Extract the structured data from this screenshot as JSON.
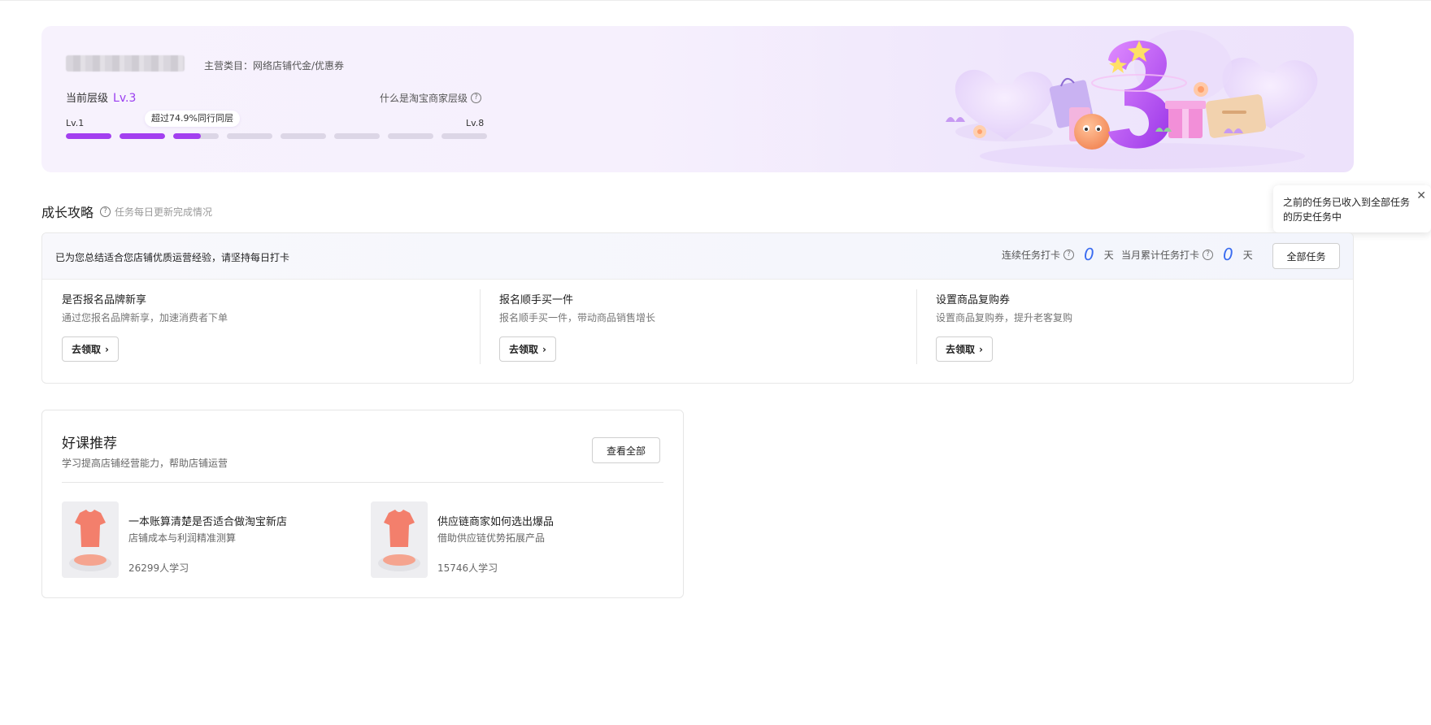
{
  "level_card": {
    "main_category": "主营类目：网络店铺代金/优惠券",
    "current_level_label": "当前层级",
    "current_level_value": "Lv.3",
    "what_is_level": "什么是淘宝商家层级",
    "level_min": "Lv.1",
    "level_max": "Lv.8",
    "percentile_text": "超过74.9%同行同层",
    "progress_segments": [
      1,
      1,
      0.6,
      0,
      0,
      0,
      0,
      0
    ],
    "progress_color": "#a33ff0"
  },
  "growth": {
    "title": "成长攻略",
    "subtitle": "任务每日更新完成情况",
    "banner_message": "已为您总结适合您店铺优质运营经验，请坚持每日打卡",
    "streak_label": "连续任务打卡",
    "streak_value": "0",
    "streak_unit": "天",
    "monthly_label": "当月累计任务打卡",
    "monthly_value": "0",
    "monthly_unit": "天",
    "all_tasks_button": "全部任务",
    "tasks": [
      {
        "title": "是否报名品牌新享",
        "desc": "通过您报名品牌新享，加速消费者下单",
        "action": "去领取"
      },
      {
        "title": "报名顺手买一件",
        "desc": "报名顺手买一件，带动商品销售增长",
        "action": "去领取"
      },
      {
        "title": "设置商品复购券",
        "desc": "设置商品复购券，提升老客复购",
        "action": "去领取"
      }
    ]
  },
  "tooltip": {
    "text": "之前的任务已收入到全部任务的历史任务中"
  },
  "courses": {
    "title": "好课推荐",
    "subtitle": "学习提高店铺经营能力，帮助店铺运营",
    "view_all": "查看全部",
    "items": [
      {
        "name": "一本账算清楚是否适合做淘宝新店",
        "desc": "店铺成本与利润精准测算",
        "learners": "26299人学习"
      },
      {
        "name": "供应链商家如何选出爆品",
        "desc": "借助供应链优势拓展产品",
        "learners": "15746人学习"
      }
    ]
  }
}
